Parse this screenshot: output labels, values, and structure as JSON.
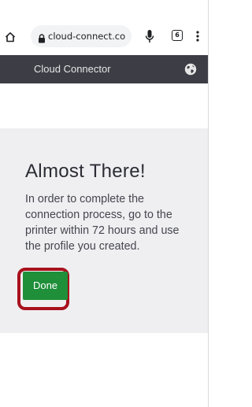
{
  "browser": {
    "url": "cloud-connect.co",
    "tab_count": "6",
    "icons": {
      "home": "home-icon",
      "lock": "lock-icon",
      "mic": "mic-icon",
      "tabs": "tabs-icon",
      "menu": "more-vert-icon"
    }
  },
  "header": {
    "title": "Cloud Connector",
    "globe_icon": "globe-icon"
  },
  "main": {
    "heading": "Almost There!",
    "description": "In order to complete the connection process, go to the printer within 72 hours and use the profile you created.",
    "done_label": "Done"
  },
  "colors": {
    "header_bg": "#3d3e45",
    "panel_bg": "#efeff2",
    "done_button": "#1f8f3a",
    "highlight": "#a8111c"
  }
}
